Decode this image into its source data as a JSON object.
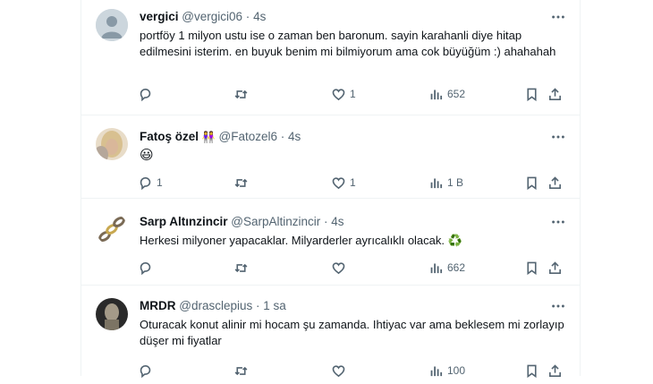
{
  "tweets": [
    {
      "name": "vergici",
      "handle": "@vergici06",
      "time": "4s",
      "text": "portföy 1 milyon ustu ise o zaman ben baronum. sayin karahanli diye hitap edilmesini isterim. en buyuk benim mi bilmiyorum ama cok büyüğüm  :) ahahahah",
      "replies": "",
      "retweets": "",
      "likes": "1",
      "views": "652"
    },
    {
      "name": "Fatoş özel",
      "badge": "👭",
      "handle": "@Fatozel6",
      "time": "4s",
      "text": "😃",
      "replies": "1",
      "retweets": "",
      "likes": "1",
      "views": "1 B"
    },
    {
      "name": "Sarp Altınzincir",
      "handle": "@SarpAltinzincir",
      "time": "4s",
      "text": "Herkesi milyoner yapacaklar. Milyarderler ayrıcalıklı olacak. ♻️",
      "replies": "",
      "retweets": "",
      "likes": "",
      "views": "662"
    },
    {
      "name": "MRDR",
      "handle": "@drasclepius",
      "time": "1 sa",
      "text": "Oturacak konut alinir mi hocam şu zamanda. Ihtiyac var ama beklesem mi zorlayıp düşer mi fiyatlar",
      "replies": "",
      "retweets": "",
      "likes": "",
      "views": "100"
    }
  ],
  "separator": "·",
  "icons": [
    "more-icon",
    "reply-icon",
    "retweet-icon",
    "like-icon",
    "views-icon",
    "bookmark-icon",
    "share-icon"
  ],
  "colors": {
    "text": "#0f1419",
    "secondary": "#536471",
    "border": "#eff3f4"
  }
}
